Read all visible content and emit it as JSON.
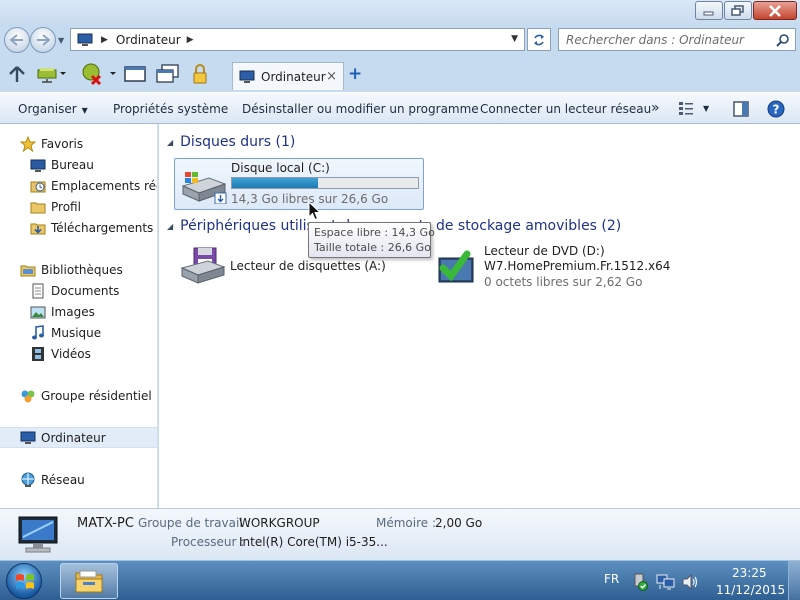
{
  "address": {
    "location": "Ordinateur",
    "search_placeholder": "Rechercher dans : Ordinateur"
  },
  "tabs": [
    {
      "label": "Ordinateur",
      "close": "×"
    }
  ],
  "tab_add": "+",
  "commands": {
    "organize": "Organiser",
    "system_properties": "Propriétés système",
    "uninstall": "Désinstaller ou modifier un programme",
    "map_drive": "Connecter un lecteur réseau",
    "more": "»"
  },
  "sidebar": {
    "favorites": "Favoris",
    "desktop": "Bureau",
    "recent": "Emplacements récents",
    "profile": "Profil",
    "downloads": "Téléchargements",
    "libraries": "Bibliothèques",
    "documents": "Documents",
    "images": "Images",
    "music": "Musique",
    "videos": "Vidéos",
    "homegroup": "Groupe résidentiel",
    "computer": "Ordinateur",
    "network": "Réseau"
  },
  "groups": {
    "hard_drives": "Disques durs (1)",
    "removable": "Périphériques utilisant des supports de stockage amovibles (2)"
  },
  "drives": {
    "local_c": {
      "name": "Disque local (C:)",
      "free_text": "14,3 Go libres sur 26,6 Go",
      "used_fraction": 0.46
    },
    "floppy": {
      "name": "Lecteur de disquettes (A:)"
    },
    "dvd": {
      "name": "Lecteur de DVD (D:)",
      "label": "W7.HomePremium.Fr.1512.x64",
      "free_text": "0 octets libres sur 2,62 Go"
    }
  },
  "tooltip": {
    "free": "Espace libre : 14,3 Go",
    "total": "Taille totale : 26,6 Go"
  },
  "details": {
    "pc_name": "MATX-PC",
    "workgroup_label": "Groupe de travail :",
    "workgroup_value": "WORKGROUP",
    "memory_label": "Mémoire :",
    "memory_value": "2,00 Go",
    "processor_label": "Processeur :",
    "processor_value": "Intel(R) Core(TM) i5-35..."
  },
  "taskbar": {
    "language": "FR",
    "time": "23:25",
    "date": "11/12/2015"
  },
  "colors": {
    "accent": "#1e3287",
    "progress": "#2a8cc4",
    "taskbar": "#3f70a6"
  }
}
